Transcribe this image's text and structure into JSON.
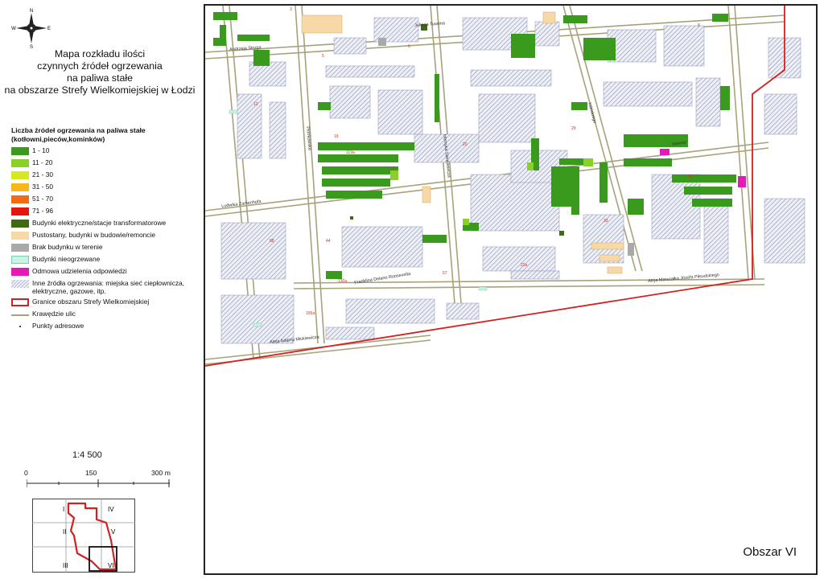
{
  "compass": {
    "n": "N",
    "s": "S",
    "e": "E",
    "w": "W"
  },
  "title": {
    "line1": "Mapa rozkładu ilości",
    "line2": "czynnych źródeł ogrzewania",
    "line3": "na paliwa stałe",
    "line4": "na obszarze Strefy Wielkomiejskiej w Łodzi"
  },
  "legend": {
    "heading_line1": "Liczba źródeł ogrzewania na paliwa stałe",
    "heading_line2": "(kotłowni,pieców,kominków)",
    "items": [
      {
        "label": "1 - 10",
        "color": "#3a9a1e"
      },
      {
        "label": "11 - 20",
        "color": "#8bcf2a"
      },
      {
        "label": "21 - 30",
        "color": "#d6e81e"
      },
      {
        "label": "31 - 50",
        "color": "#f7b61b"
      },
      {
        "label": "51 - 70",
        "color": "#ef6a12"
      },
      {
        "label": "71 - 96",
        "color": "#e3170f"
      },
      {
        "label": "Budynki elektryczne/stacje transformatorowe",
        "color": "#3d6b12"
      },
      {
        "label": "Pustostany, budynki w budowie/remoncie",
        "color": "#f7d9a8"
      },
      {
        "label": "Brak budynku w terenie",
        "color": "#a9a9a9"
      },
      {
        "label": "Budynki nieogrzewane",
        "color": "#c8f2e6"
      },
      {
        "label": "Odmowa udzielenia odpowiedzi",
        "color": "#e419b8"
      },
      {
        "label": "Inne źródła ogrzewania: miejska sieć ciepłownicza, elektryczne, gazowe, itp.",
        "color": "#b9c0d6"
      },
      {
        "label": "Granice obszaru Strefy Wielkomiejskiej",
        "color": "#d32020"
      },
      {
        "label": "Krawędzie ulic",
        "color": "#a8a27a"
      },
      {
        "label": "Punkty adresowe",
        "color": "#444444"
      }
    ]
  },
  "scale": {
    "ratio": "1:4 500",
    "label_0": "0",
    "label_150": "150",
    "label_300": "300 m"
  },
  "index_map": {
    "labels": [
      "I",
      "II",
      "III",
      "IV",
      "V",
      "VI"
    ],
    "highlighted": "VI"
  },
  "map": {
    "area_label": "Obszar VI",
    "streets": [
      "Juliana Tuwima",
      "Andrzeja Struga",
      "Ludwika Zamenhofa",
      "Franklina Delano Roosevelta",
      "Aleja Adama Mickiewicza",
      "Aleja Marszałka Józefa Piłsudskiego",
      "Piotrkowska",
      "Henryka Sienkiewicza",
      "Kilińskiego",
      "Nawrot"
    ],
    "address_numbers": [
      "12",
      "14",
      "19",
      "20",
      "22a",
      "29",
      "33",
      "44",
      "67",
      "88",
      "119a",
      "130a",
      "155a",
      "3",
      "5",
      "6",
      "8",
      "10"
    ]
  }
}
